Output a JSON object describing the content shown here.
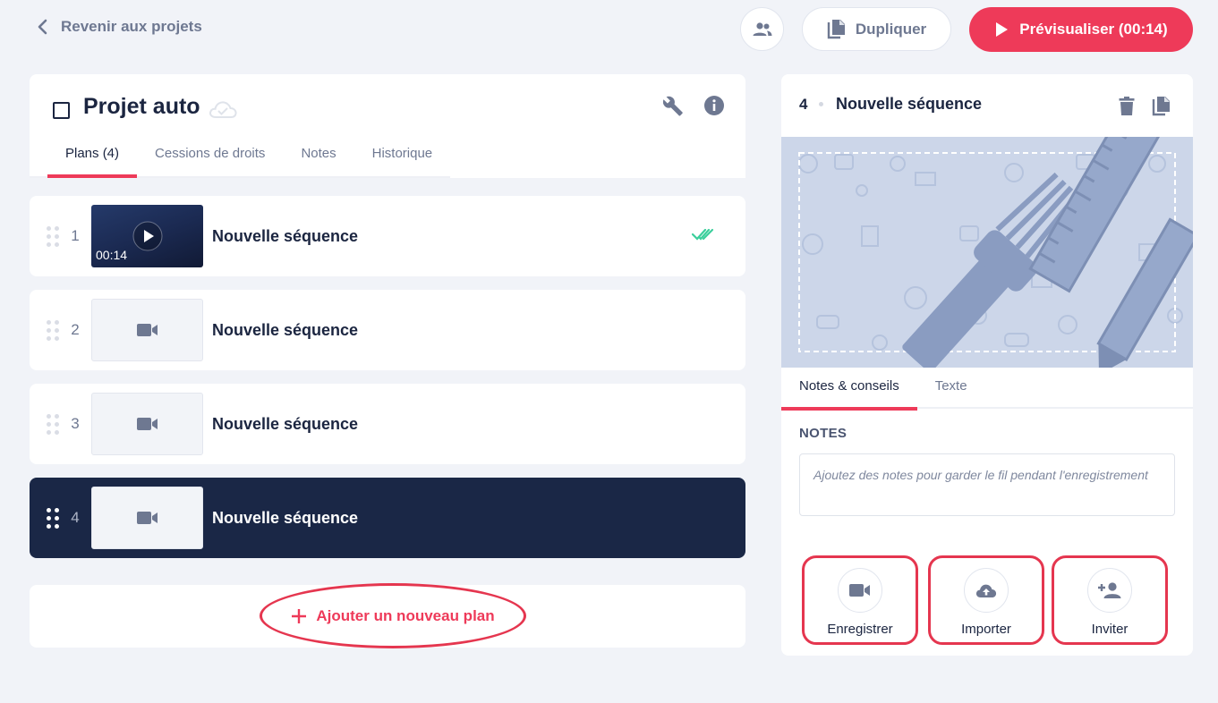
{
  "header": {
    "back_label": "Revenir aux projets",
    "duplicate_label": "Dupliquer",
    "preview_label": "Prévisualiser (00:14)"
  },
  "project": {
    "title": "Projet auto",
    "tabs": [
      {
        "label": "Plans (4)",
        "active": true
      },
      {
        "label": "Cessions de droits",
        "active": false
      },
      {
        "label": "Notes",
        "active": false
      },
      {
        "label": "Historique",
        "active": false
      }
    ]
  },
  "plans": [
    {
      "number": "1",
      "title": "Nouvelle séquence",
      "duration": "00:14",
      "has_video": true,
      "validated": true,
      "selected": false
    },
    {
      "number": "2",
      "title": "Nouvelle séquence",
      "has_video": false,
      "selected": false
    },
    {
      "number": "3",
      "title": "Nouvelle séquence",
      "has_video": false,
      "selected": false
    },
    {
      "number": "4",
      "title": "Nouvelle séquence",
      "has_video": false,
      "selected": true
    }
  ],
  "add_plan_label": "Ajouter un nouveau plan",
  "detail": {
    "number": "4",
    "title": "Nouvelle séquence",
    "tabs": [
      {
        "label": "Notes & conseils",
        "active": true
      },
      {
        "label": "Texte",
        "active": false
      }
    ],
    "notes_label": "NOTES",
    "notes_placeholder": "Ajoutez des notes pour garder le fil pendant l'enregistrement",
    "actions": [
      {
        "label": "Enregistrer",
        "icon": "video-camera-icon"
      },
      {
        "label": "Importer",
        "icon": "cloud-upload-icon"
      },
      {
        "label": "Inviter",
        "icon": "add-person-icon"
      }
    ]
  },
  "colors": {
    "accent": "#ee3a59",
    "navy": "#1a2746",
    "background": "#f1f3f8",
    "validated": "#3ccf9c"
  }
}
